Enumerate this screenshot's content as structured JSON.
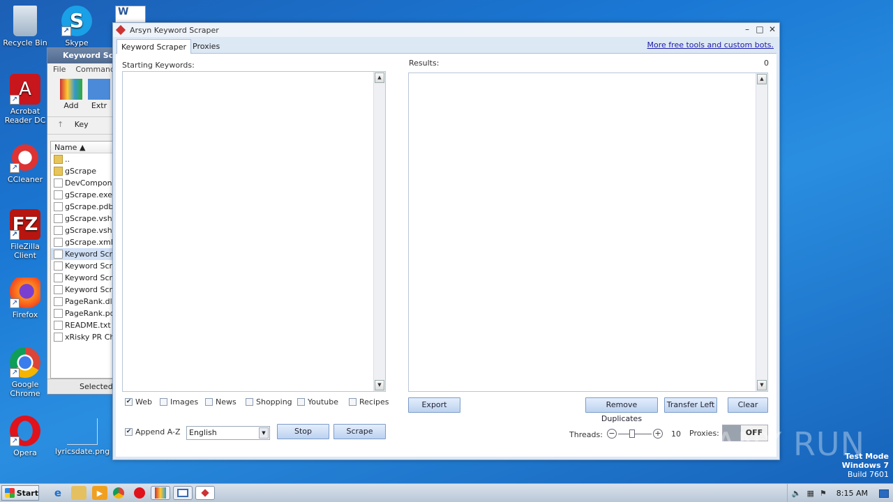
{
  "desktop": {
    "icons": [
      {
        "label": "Recycle Bin",
        "icon": "recycle-bin-icon"
      },
      {
        "label": "Skype",
        "icon": "skype-icon"
      },
      {
        "label": "Acrobat Reader DC",
        "icon": "acrobat-icon"
      },
      {
        "label": "CCleaner",
        "icon": "ccleaner-icon"
      },
      {
        "label": "FileZilla Client",
        "icon": "filezilla-icon"
      },
      {
        "label": "Firefox",
        "icon": "firefox-icon"
      },
      {
        "label": "Google Chrome",
        "icon": "chrome-icon"
      },
      {
        "label": "Opera",
        "icon": "opera-icon"
      },
      {
        "label": "lyricsdate.png",
        "icon": "image-file-icon"
      }
    ],
    "watermark": "ANY RUN",
    "test_mode": {
      "line1": "Test Mode",
      "line2": "Windows 7",
      "line3": "Build 7601"
    }
  },
  "winrar": {
    "title": "Keyword Scr",
    "menu": [
      "File",
      "Commands"
    ],
    "toolbar": [
      "Add",
      "Extr"
    ],
    "address": "Key",
    "column_name": "Name",
    "files": [
      {
        "name": "..",
        "type": "folder"
      },
      {
        "name": "gScrape",
        "type": "folder"
      },
      {
        "name": "DevComponer",
        "type": "file"
      },
      {
        "name": "gScrape.exe",
        "type": "file"
      },
      {
        "name": "gScrape.pdb",
        "type": "file"
      },
      {
        "name": "gScrape.vsho",
        "type": "file"
      },
      {
        "name": "gScrape.vsho",
        "type": "file"
      },
      {
        "name": "gScrape.xml",
        "type": "file"
      },
      {
        "name": "Keyword Scra",
        "type": "selected"
      },
      {
        "name": "Keyword Scra",
        "type": "file"
      },
      {
        "name": "Keyword Scra",
        "type": "file"
      },
      {
        "name": "Keyword Scra",
        "type": "file"
      },
      {
        "name": "PageRank.dll",
        "type": "file"
      },
      {
        "name": "PageRank.pdb",
        "type": "file"
      },
      {
        "name": "README.txt",
        "type": "file"
      },
      {
        "name": "xRisky PR Che",
        "type": "file"
      }
    ],
    "status": "Selected"
  },
  "app": {
    "title": "Arsyn Keyword Scraper",
    "tabs": [
      "Keyword Scraper",
      "Proxies"
    ],
    "link": "More free tools and custom bots.",
    "starting_label": "Starting Keywords:",
    "results_label": "Results:",
    "results_count": "0",
    "sources": [
      {
        "label": "Web",
        "checked": true
      },
      {
        "label": "Images",
        "checked": false
      },
      {
        "label": "News",
        "checked": false
      },
      {
        "label": "Shopping",
        "checked": false
      },
      {
        "label": "Youtube",
        "checked": false
      },
      {
        "label": "Recipes",
        "checked": false
      }
    ],
    "append_label": "Append A-Z",
    "append_checked": true,
    "language": "English",
    "buttons": {
      "stop": "Stop",
      "scrape": "Scrape",
      "export": "Export",
      "remove_duplicates": "Remove Duplicates",
      "transfer_left": "Transfer Left",
      "clear": "Clear"
    },
    "threads_label": "Threads:",
    "threads_value": "10",
    "proxies_label": "Proxies:",
    "proxies_toggle": "OFF"
  },
  "taskbar": {
    "start": "Start",
    "clock": "8:15 AM"
  }
}
